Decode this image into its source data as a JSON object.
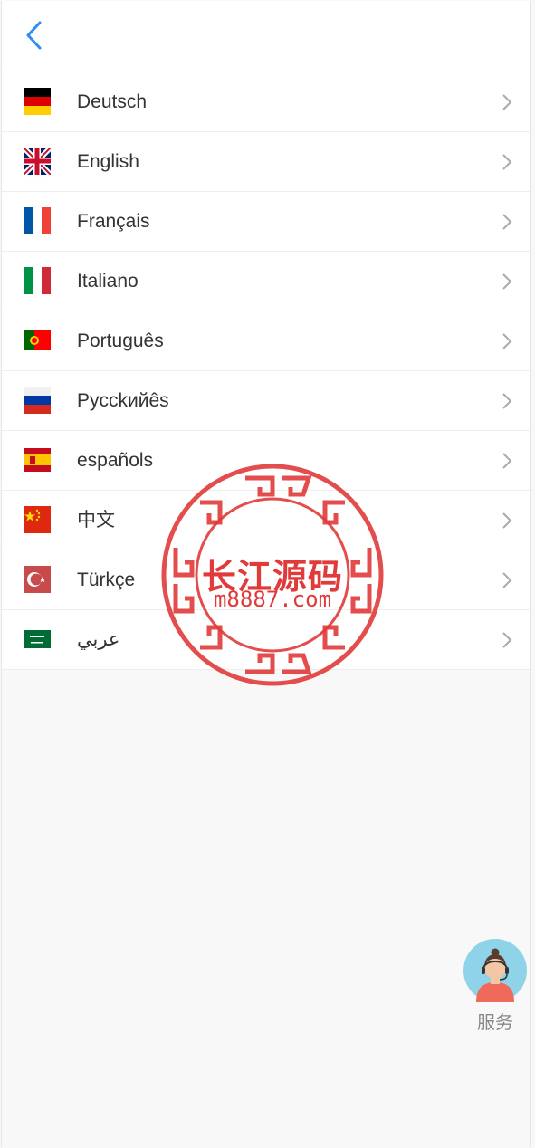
{
  "header": {
    "back_icon": "chevron-left-icon",
    "accent_color": "#2f8cf0"
  },
  "languages": [
    {
      "label": "Deutsch",
      "flag": "germany-flag-icon"
    },
    {
      "label": "English",
      "flag": "uk-flag-icon"
    },
    {
      "label": "Français",
      "flag": "france-flag-icon"
    },
    {
      "label": "Italiano",
      "flag": "italy-flag-icon"
    },
    {
      "label": "Português",
      "flag": "portugal-flag-icon"
    },
    {
      "label": "Pycckийês",
      "flag": "russia-flag-icon"
    },
    {
      "label": "españols",
      "flag": "spain-flag-icon"
    },
    {
      "label": "中文",
      "flag": "china-flag-icon"
    },
    {
      "label": "Türkçe",
      "flag": "turkey-flag-icon"
    },
    {
      "label": "عربي",
      "flag": "saudi-flag-icon"
    }
  ],
  "service": {
    "label": "服务",
    "icon": "customer-service-avatar-icon"
  },
  "watermark": {
    "title": "长江源码",
    "subtitle": "m8887.com",
    "color": "#e03a3a"
  }
}
